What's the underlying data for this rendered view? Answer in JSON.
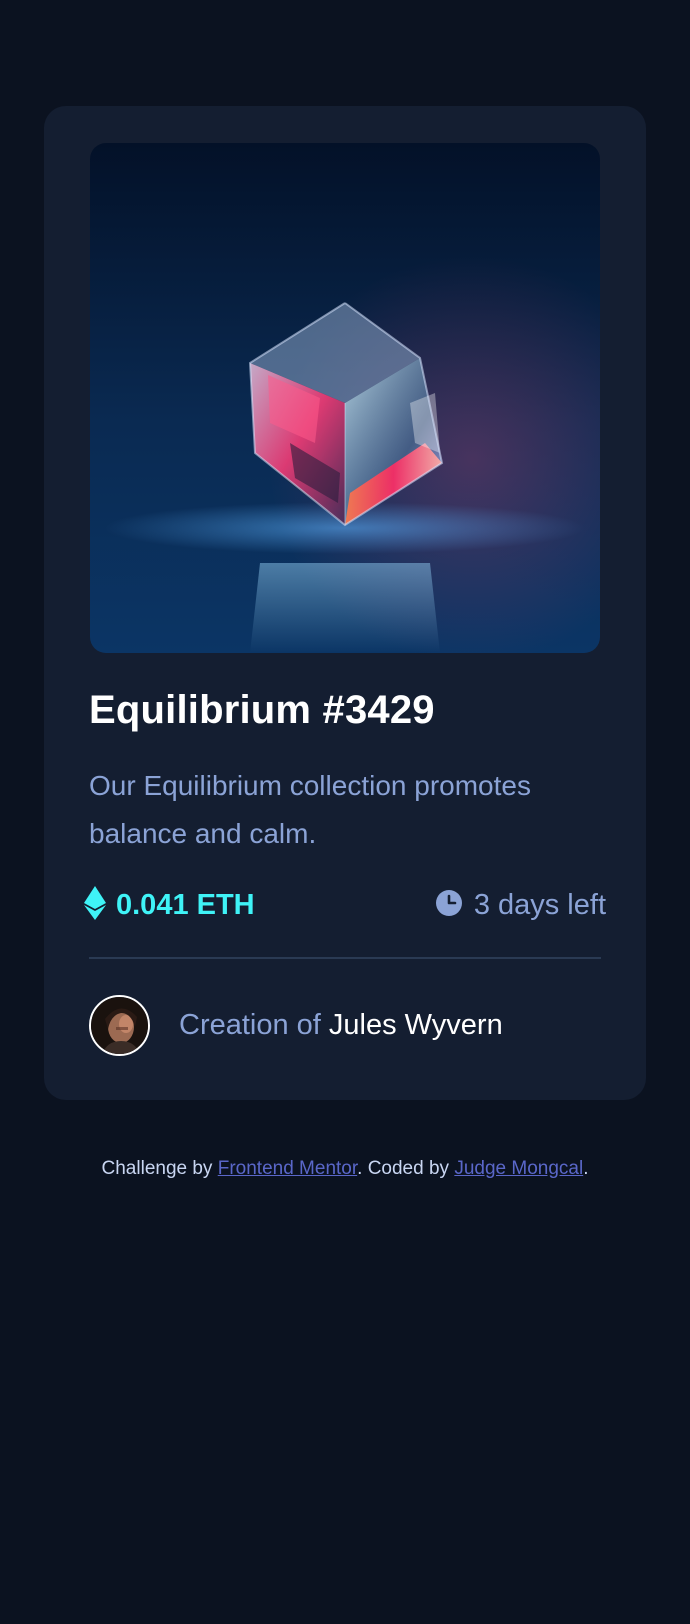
{
  "card": {
    "image": {
      "alt": "Equilibrium NFT image",
      "subject": "glowing-glass-cube",
      "colors": {
        "background_top": "#031128",
        "background_bottom": "#0b3260",
        "glow_pink": "#ff2a63",
        "glow_cyan": "#7fd7ff"
      }
    },
    "title": "Equilibrium #3429",
    "description": "Our Equilibrium collection promotes balance and calm.",
    "price": {
      "icon": "ethereum-icon",
      "value": "0.041 ETH"
    },
    "time_left": {
      "icon": "clock-icon",
      "value": "3 days left"
    },
    "creator": {
      "avatar_icon": "avatar",
      "prefix": "Creation of",
      "name": "Jules Wyvern"
    }
  },
  "footer": {
    "challenge_prefix": "Challenge by",
    "challenge_link": "Frontend Mentor",
    "coded_prefix": ". Coded by",
    "coded_link": "Judge Mongcal",
    "suffix": "."
  },
  "colors": {
    "page_bg": "#0b1220",
    "card_bg": "#141e31",
    "accent_cyan": "#3ff3f7",
    "muted_blue": "#8ba3d6",
    "white": "#ffffff",
    "link": "#5a67c9",
    "divider": "#2a3a53"
  }
}
